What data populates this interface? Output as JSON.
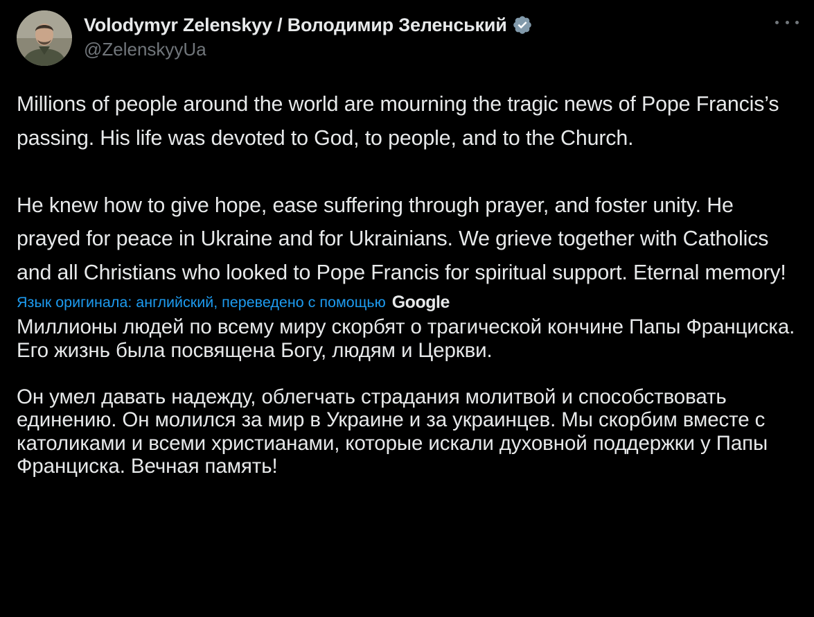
{
  "author": {
    "display_name": "Volodymyr Zelenskyy / Володимир Зеленський",
    "handle": "@ZelenskyyUa",
    "verified_icon": "verified-badge-icon",
    "avatar_icon": "profile-photo"
  },
  "menu": {
    "icon": "more-options-icon"
  },
  "tweet": {
    "paragraphs": [
      "Millions of people around the world are mourning the tragic news of Pope Francis’s passing. His life was devoted to God, to people, and to the Church.",
      "He knew how to give hope, ease suffering through prayer, and foster unity. He prayed for peace in Ukraine and for Ukrainians. We grieve together with Catholics and all Christians who looked to Pope Francis for spiritual support. Eternal memory!"
    ]
  },
  "translation": {
    "label": "Язык оригинала: английский, переведено с помощью",
    "provider": "Google",
    "paragraphs": [
      "Миллионы людей по всему миру скорбят о трагической кончине Папы Франциска. Его жизнь была посвящена Богу, людям и Церкви.",
      "Он умел давать надежду, облегчать страдания молитвой и способствовать единению. Он молился за мир в Украине и за украинцев. Мы скорбим вместе с католиками и всеми христианами, которые искали духовной поддержки у Папы Франциска. Вечная память!"
    ]
  },
  "colors": {
    "background": "#000000",
    "text": "#e7e9ea",
    "secondary": "#71767b",
    "link": "#1d9bf0",
    "verified": "#829aab"
  }
}
